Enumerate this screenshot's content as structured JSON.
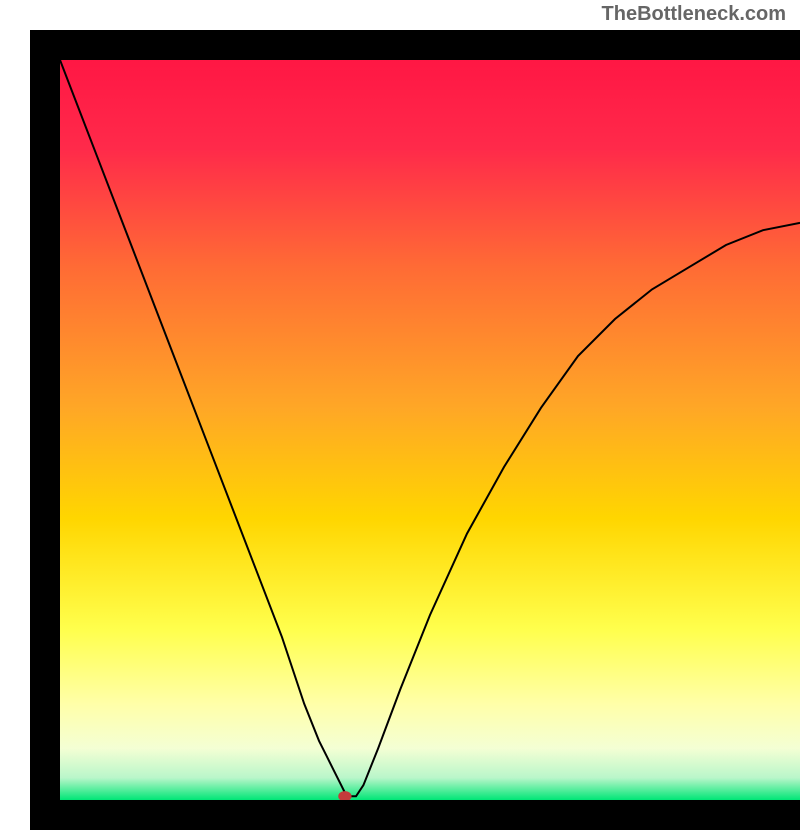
{
  "watermark": "TheBottleneck.com",
  "chart_data": {
    "type": "line",
    "title": "",
    "xlabel": "",
    "ylabel": "",
    "xlim": [
      0,
      100
    ],
    "ylim": [
      0,
      100
    ],
    "x": [
      0,
      5,
      10,
      15,
      20,
      25,
      30,
      33,
      35,
      36,
      37,
      38,
      38.5,
      39,
      40,
      41,
      43,
      46,
      50,
      55,
      60,
      65,
      70,
      75,
      80,
      85,
      90,
      95,
      100
    ],
    "values": [
      100,
      87,
      74,
      61,
      48,
      35,
      22,
      13,
      8,
      6,
      4,
      2,
      1,
      0.5,
      0.5,
      2,
      7,
      15,
      25,
      36,
      45,
      53,
      60,
      65,
      69,
      72,
      75,
      77,
      78
    ],
    "notes": "V-shaped curve; left branch linear from (0, 100) to minimum ~(38.5, 0.5); right branch rises with decreasing slope; red marker at optimal point near x=38.5, y=0.5",
    "gradient": {
      "top": "#ff1744",
      "mid_upper": "#ff6b35",
      "mid": "#ffd600",
      "mid_lower": "#ffff8d",
      "bottom": "#00e676"
    },
    "marker": {
      "x": 38.5,
      "y": 0.5,
      "color": "#c43b3b"
    }
  }
}
